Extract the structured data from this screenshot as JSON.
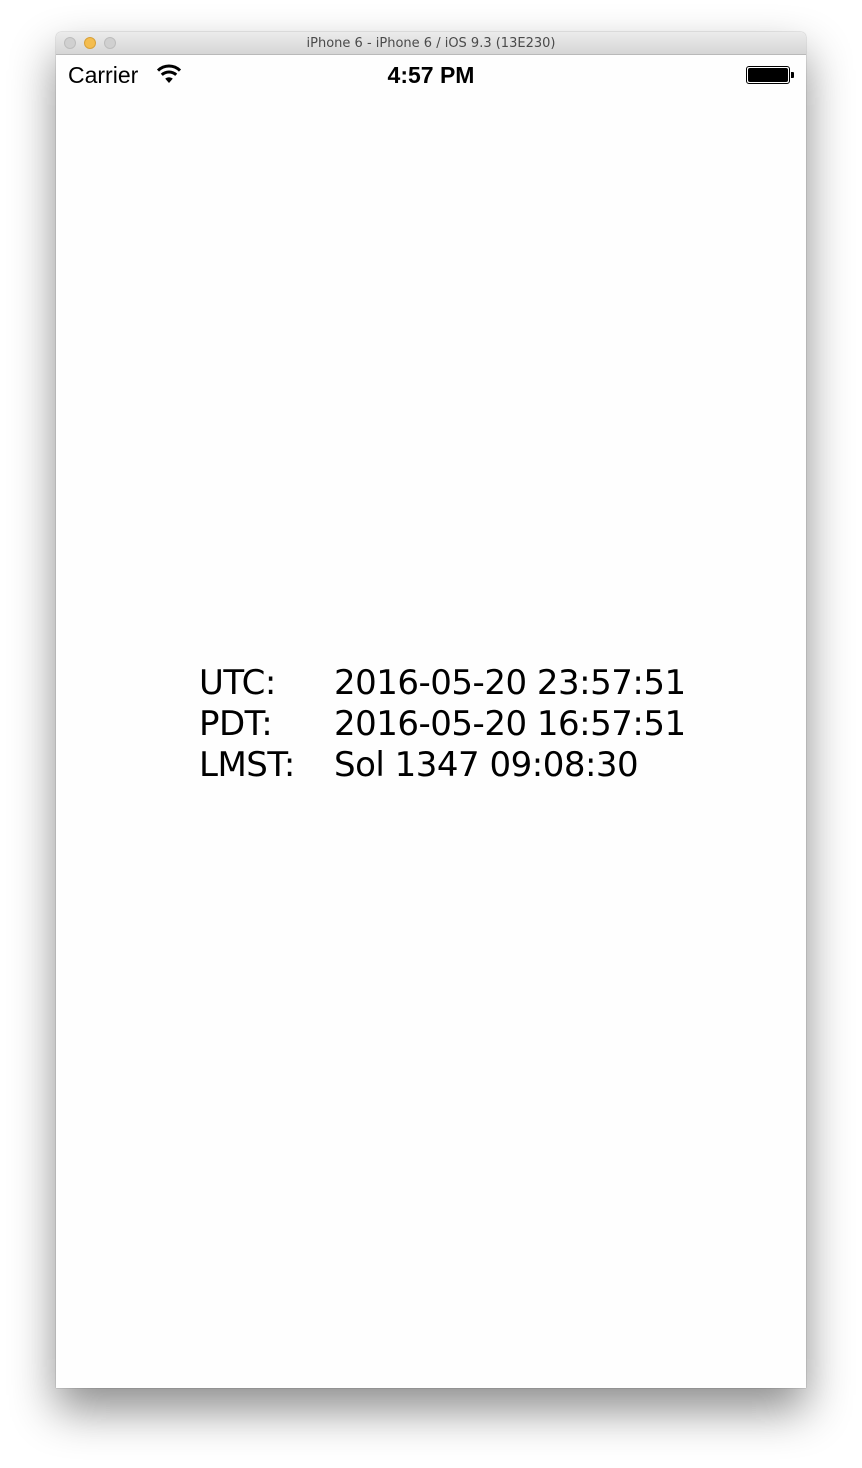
{
  "window": {
    "title": "iPhone 6 - iPhone 6 / iOS 9.3 (13E230)"
  },
  "statusbar": {
    "carrier": "Carrier",
    "time": "4:57 PM",
    "signal_icon": "wifi-icon",
    "battery_icon": "battery-icon",
    "battery_level": 1.0
  },
  "times": [
    {
      "label": "UTC:",
      "value": "2016-05-20 23:57:51"
    },
    {
      "label": "PDT:",
      "value": "2016-05-20 16:57:51"
    },
    {
      "label": "LMST:",
      "value": "Sol 1347 09:08:30"
    }
  ],
  "colors": {
    "minimize_button": "#f4bd4f",
    "inactive_button": "#d0d0d0",
    "text": "#000000"
  }
}
